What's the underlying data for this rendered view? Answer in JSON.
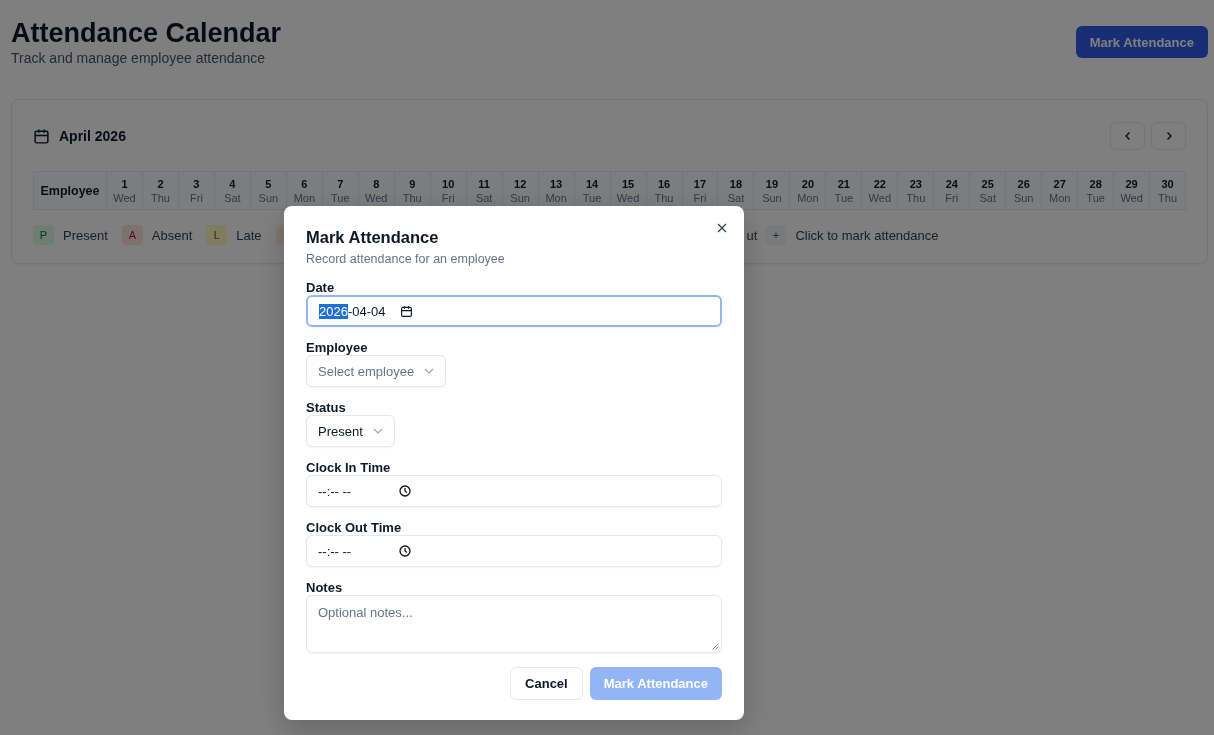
{
  "header": {
    "title": "Attendance Calendar",
    "subtitle": "Track and manage employee attendance",
    "action": "Mark Attendance"
  },
  "calendar": {
    "month": "April 2026",
    "employee_header": "Employee",
    "days": [
      {
        "day": "1",
        "weekday": "Wed"
      },
      {
        "day": "2",
        "weekday": "Thu"
      },
      {
        "day": "3",
        "weekday": "Fri"
      },
      {
        "day": "4",
        "weekday": "Sat"
      },
      {
        "day": "5",
        "weekday": "Sun"
      },
      {
        "day": "6",
        "weekday": "Mon"
      },
      {
        "day": "7",
        "weekday": "Tue"
      },
      {
        "day": "8",
        "weekday": "Wed"
      },
      {
        "day": "9",
        "weekday": "Thu"
      },
      {
        "day": "10",
        "weekday": "Fri"
      },
      {
        "day": "11",
        "weekday": "Sat"
      },
      {
        "day": "12",
        "weekday": "Sun"
      },
      {
        "day": "13",
        "weekday": "Mon"
      },
      {
        "day": "14",
        "weekday": "Tue"
      },
      {
        "day": "15",
        "weekday": "Wed"
      },
      {
        "day": "16",
        "weekday": "Thu"
      },
      {
        "day": "17",
        "weekday": "Fri"
      },
      {
        "day": "18",
        "weekday": "Sat"
      },
      {
        "day": "19",
        "weekday": "Sun"
      },
      {
        "day": "20",
        "weekday": "Mon"
      },
      {
        "day": "21",
        "weekday": "Tue"
      },
      {
        "day": "22",
        "weekday": "Wed"
      },
      {
        "day": "23",
        "weekday": "Thu"
      },
      {
        "day": "24",
        "weekday": "Fri"
      },
      {
        "day": "25",
        "weekday": "Sat"
      },
      {
        "day": "26",
        "weekday": "Sun"
      },
      {
        "day": "27",
        "weekday": "Mon"
      },
      {
        "day": "28",
        "weekday": "Tue"
      },
      {
        "day": "29",
        "weekday": "Wed"
      },
      {
        "day": "30",
        "weekday": "Thu"
      }
    ]
  },
  "legend": [
    {
      "badge": "P",
      "label": "Present",
      "kind": "present"
    },
    {
      "badge": "A",
      "label": "Absent",
      "kind": "absent"
    },
    {
      "badge": "L",
      "label": "Late",
      "kind": "late"
    },
    {
      "kind": "other"
    }
  ],
  "legend_fragment": "ut",
  "hint": {
    "badge": "+",
    "label": "Click to mark attendance"
  },
  "dialog": {
    "title": "Mark Attendance",
    "subtitle": "Record attendance for an employee",
    "fields": [
      {
        "kind": "date",
        "label": "Date",
        "value": "2026-04-04",
        "focused": true
      },
      {
        "kind": "select",
        "label": "Employee",
        "placeholder": "Select employee"
      },
      {
        "kind": "select",
        "label": "Status",
        "value": "Present"
      },
      {
        "kind": "time",
        "label": "Clock In Time",
        "value": "--:-- --"
      },
      {
        "kind": "time",
        "label": "Clock Out Time",
        "value": "--:-- --"
      },
      {
        "kind": "textarea",
        "label": "Notes",
        "placeholder": "Optional notes..."
      }
    ],
    "buttons": [
      {
        "label": "Cancel",
        "kind": "secondary"
      },
      {
        "label": "Mark Attendance",
        "kind": "primary",
        "disabled": true
      }
    ]
  }
}
